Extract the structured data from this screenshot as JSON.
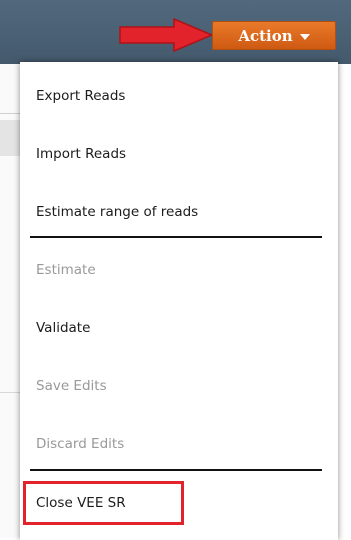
{
  "toolbar": {
    "action_label": "Action",
    "action_icon": "caret-down-icon",
    "accent_color": "#e06a1e"
  },
  "annotation": {
    "arrow_color": "#e3232b",
    "highlight_color": "#e3232b"
  },
  "menu": {
    "items": [
      {
        "label": "Export Reads",
        "enabled": true
      },
      {
        "label": "Import Reads",
        "enabled": true
      },
      {
        "label": "Estimate range of reads",
        "enabled": true
      },
      {
        "label": "Estimate",
        "enabled": false
      },
      {
        "label": "Validate",
        "enabled": true
      },
      {
        "label": "Save Edits",
        "enabled": false
      },
      {
        "label": "Discard Edits",
        "enabled": false
      },
      {
        "label": "Close VEE SR",
        "enabled": true,
        "highlighted": true
      }
    ]
  }
}
